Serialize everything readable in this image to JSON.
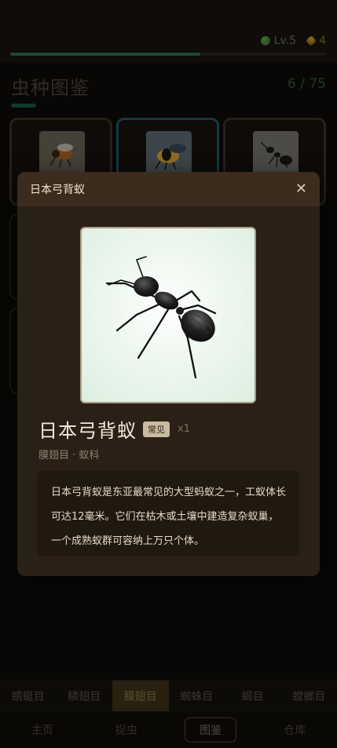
{
  "header": {
    "level": "Lv.5",
    "coins": "4",
    "level_icon": "globe-icon",
    "coin_icon": "coin-icon",
    "xp_progress": 0.6
  },
  "codex": {
    "title": "虫种图鉴",
    "count": "6 / 75"
  },
  "category_tabs": [
    "蜻蜓目",
    "鳞翅目",
    "膜翅目",
    "蜘蛛目",
    "蝎目",
    "螳螂目"
  ],
  "active_category": 2,
  "bottom_nav": [
    "主页",
    "捉虫",
    "图鉴",
    "仓库"
  ],
  "active_nav": 2,
  "modal": {
    "title": "日本弓背蚁",
    "close_symbol": "✕",
    "name": "日本弓背蚁",
    "rarity": "常见",
    "quantity": "x1",
    "taxonomy": "膜翅目 · 蚁科",
    "description": "日本弓背蚁是东亚最常见的大型蚂蚁之一，工蚁体长可达12毫米。它们在枯木或土壤中建造复杂蚁巢，一个成熟蚁群可容纳上万只个体。"
  },
  "colors": {
    "accent_green": "#2e6e52",
    "modal_bg": "#2b2016",
    "modal_header": "#3b2c1e",
    "active_tab": "#3e3419"
  }
}
